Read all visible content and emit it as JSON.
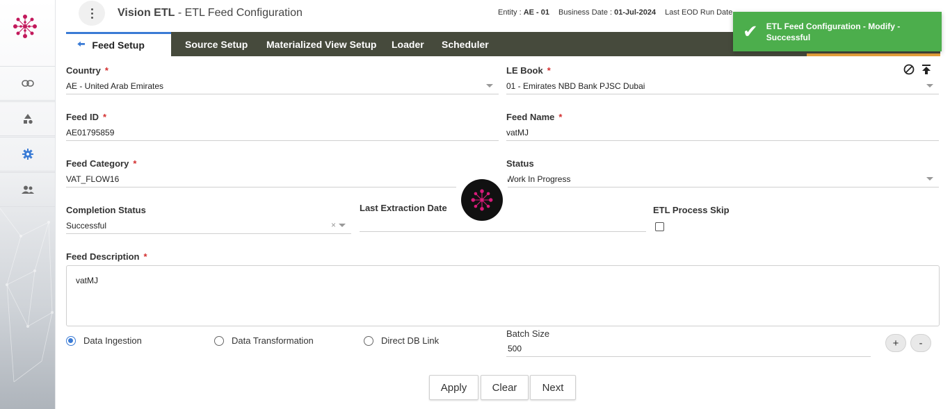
{
  "header": {
    "app_name": "Vision ETL",
    "page_title": " - ETL Feed Configuration",
    "entity_label": "Entity : ",
    "entity_value": "AE - 01",
    "business_date_label": "Business Date : ",
    "business_date_value": "01-Jul-2024",
    "last_eod_label": "Last EOD Run Date"
  },
  "sidebar": {
    "items": [
      {
        "icon": "link-icon"
      },
      {
        "icon": "shapes-icon"
      },
      {
        "icon": "gear-icon"
      },
      {
        "icon": "users-icon"
      }
    ]
  },
  "tabs": {
    "active": "Feed Setup",
    "items": [
      "Source Setup",
      "Materialized View Setup",
      "Loader",
      "Scheduler"
    ]
  },
  "toast": {
    "message": "ETL Feed Configuration - Modify - Successful",
    "color": "#4cae4c"
  },
  "form": {
    "country": {
      "label": "Country",
      "value": "AE - United Arab Emirates"
    },
    "le_book": {
      "label": "LE Book",
      "value": "01 - Emirates NBD Bank PJSC Dubai"
    },
    "feed_id": {
      "label": "Feed ID",
      "value": "AE01795859"
    },
    "feed_name": {
      "label": "Feed Name",
      "value": "vatMJ"
    },
    "feed_category": {
      "label": "Feed Category",
      "value": "VAT_FLOW16"
    },
    "status": {
      "label": "Status",
      "value": "Work In Progress"
    },
    "completion_status": {
      "label": "Completion Status",
      "value": "Successful"
    },
    "last_extraction_date": {
      "label": "Last Extraction Date",
      "value": ""
    },
    "etl_process_skip": {
      "label": "ETL Process Skip",
      "checked": false
    },
    "feed_description": {
      "label": "Feed Description",
      "value": "vatMJ"
    },
    "required_mark": "*",
    "feed_type": {
      "options": [
        "Data Ingestion",
        "Data Transformation",
        "Direct DB Link"
      ],
      "selected": "Data Ingestion"
    },
    "batch_size": {
      "label": "Batch Size",
      "value": "500"
    }
  },
  "buttons": {
    "apply": "Apply",
    "clear": "Clear",
    "next": "Next",
    "plus": "+",
    "minus": "-"
  },
  "colors": {
    "accent": "#3a7bd5",
    "tabbar": "#464a3c",
    "required": "#d32f2f",
    "tab_highlight": "#e8a23b"
  }
}
